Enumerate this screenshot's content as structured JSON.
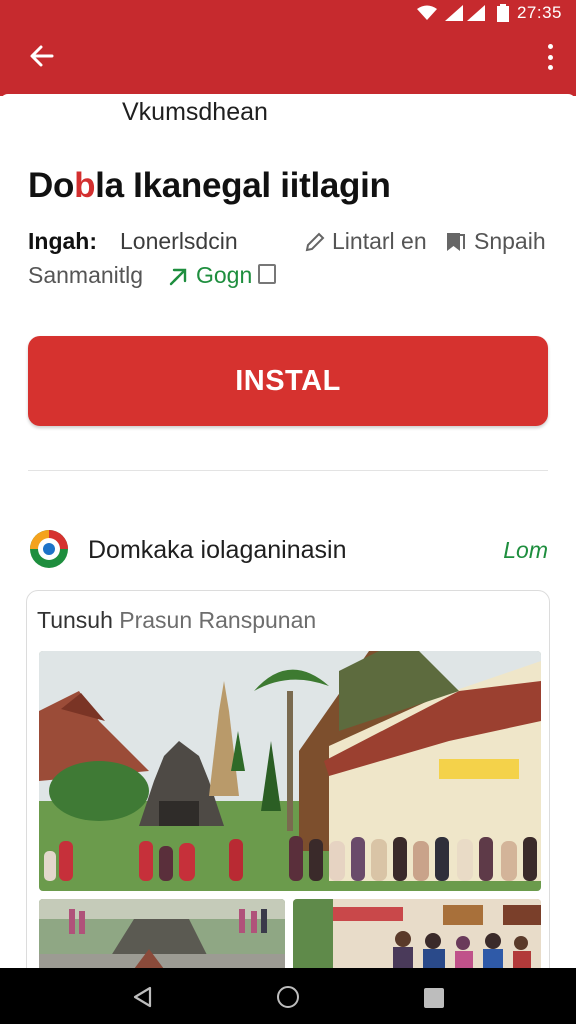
{
  "status_bar": {
    "time": "27:35",
    "icons": [
      "wifi-icon",
      "signal-icon",
      "battery-icon"
    ]
  },
  "app_bar": {
    "back_icon": "arrow-left-icon",
    "menu_icon": "more-vert-icon",
    "color": "#c62a2e"
  },
  "header": {
    "subtitle": "Vkumsdhean",
    "title_prefix": "Do",
    "title_highlight": "b",
    "title_suffix": "la Ikanegal iitlagin"
  },
  "meta": {
    "label": "Ingah:",
    "value": "Lonerlsdcin",
    "action1": "Lintarl en",
    "action2": "Snpaih",
    "sub_text": "Sanmanitlg",
    "green_link": "Gogn"
  },
  "install_button": {
    "label": "INSTAL",
    "color": "#d6322f"
  },
  "developer": {
    "name": "Domkaka iolaganinasin",
    "link": "Lom"
  },
  "gallery": {
    "title_dark": "Tunsuh",
    "title_light": "Prasun Ranspunan"
  }
}
